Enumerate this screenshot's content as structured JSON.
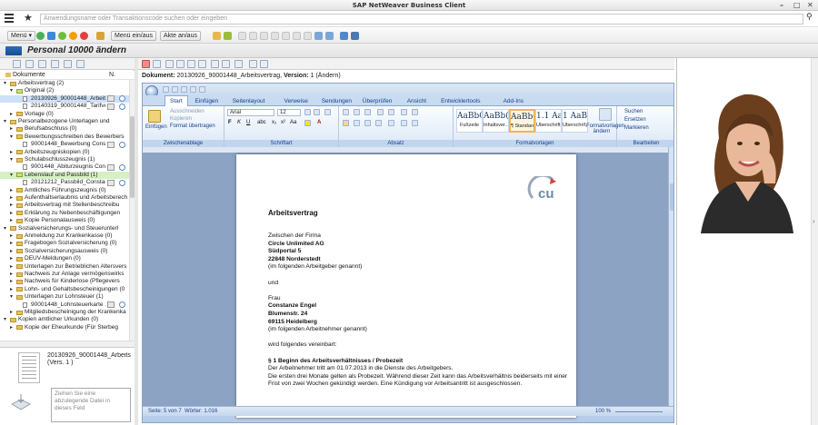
{
  "window": {
    "title": "SAP NetWeaver Business Client"
  },
  "command": {
    "placeholder": "Anwendungsname oder Transaktionscode suchen oder eingeben"
  },
  "toolbar": {
    "menu": "Menü",
    "menu_onoff": "Menü ein/aus",
    "file_onoff": "Akte an/aus"
  },
  "page": {
    "title": "Personal 10000 ändern"
  },
  "tree": {
    "header": "Dokumente",
    "col_n": "N.",
    "rows": [
      {
        "level": 1,
        "text": "Arbeitsvertrag (2)",
        "type": "folder",
        "exp": "open"
      },
      {
        "level": 2,
        "text": "Original (2)",
        "type": "folder-green",
        "exp": "open"
      },
      {
        "level": 3,
        "text": "20130926_90001448_Arbeitsv",
        "type": "doc",
        "selected": true,
        "icons": true
      },
      {
        "level": 3,
        "text": "20140319_90001448_Tarifvertr",
        "type": "doc",
        "icons": true
      },
      {
        "level": 2,
        "text": "Vorlage (0)",
        "type": "folder",
        "exp": "closed"
      },
      {
        "level": 1,
        "text": "Personalbezogene Unterlagen und",
        "type": "folder",
        "exp": "open"
      },
      {
        "level": 2,
        "text": "Berufsabschluss (0)",
        "type": "folder",
        "exp": "closed"
      },
      {
        "level": 2,
        "text": "Bewerbungsschreiben des Bewerbers",
        "type": "folder",
        "exp": "open"
      },
      {
        "level": 3,
        "text": "90001448_Bewerbung Constanz",
        "type": "doc",
        "icons": true
      },
      {
        "level": 2,
        "text": "Arbeitszeugniskopien (0)",
        "type": "folder",
        "exp": "closed"
      },
      {
        "level": 2,
        "text": "Schulabschlusszeugnis (1)",
        "type": "folder",
        "exp": "open"
      },
      {
        "level": 3,
        "text": "9001448_Abiturzeugnis Consta",
        "type": "doc",
        "icons": true
      },
      {
        "level": 2,
        "text": "Lebenslauf und Passbild (1)",
        "type": "folder-green",
        "exp": "open",
        "green": true
      },
      {
        "level": 3,
        "text": "20121212_Passbild_Constanze",
        "type": "doc",
        "icons": true
      },
      {
        "level": 2,
        "text": "Amtliches Führungszeugnis (0)",
        "type": "folder",
        "exp": "closed"
      },
      {
        "level": 2,
        "text": "Aufenthaltserlaubnis und Arbeitsberech",
        "type": "folder",
        "exp": "closed"
      },
      {
        "level": 2,
        "text": "Arbeitsvertrag mit Stellenbeschreibu",
        "type": "folder",
        "exp": "closed"
      },
      {
        "level": 2,
        "text": "Erklärung zu Nebenbeschäftigungen",
        "type": "folder",
        "exp": "closed"
      },
      {
        "level": 2,
        "text": "Kopie Personalausweis (0)",
        "type": "folder",
        "exp": "closed"
      },
      {
        "level": 1,
        "text": "Sozialversicherungs- und Steuerunterl",
        "type": "folder",
        "exp": "open"
      },
      {
        "level": 2,
        "text": "Anmeldung zur Krankenkasse (0)",
        "type": "folder",
        "exp": "closed"
      },
      {
        "level": 2,
        "text": "Fragebogen Sozialversicherung (0)",
        "type": "folder",
        "exp": "closed"
      },
      {
        "level": 2,
        "text": "Sozialversicherungsausweis (0)",
        "type": "folder",
        "exp": "closed"
      },
      {
        "level": 2,
        "text": "DEÜV-Meldungen (0)",
        "type": "folder",
        "exp": "closed"
      },
      {
        "level": 2,
        "text": "Unterlagen zur Betrieblichen Altersvers",
        "type": "folder",
        "exp": "closed"
      },
      {
        "level": 2,
        "text": "Nachweis zur Anlage vermögenswirks",
        "type": "folder",
        "exp": "closed"
      },
      {
        "level": 2,
        "text": "Nachweis für Kinderlose (Pflegevers",
        "type": "folder",
        "exp": "closed"
      },
      {
        "level": 2,
        "text": "Lohn- und Gehaltsbescheinigungen (0",
        "type": "folder",
        "exp": "closed"
      },
      {
        "level": 2,
        "text": "Unterlagen zur Lohnsteuer (1)",
        "type": "folder",
        "exp": "open"
      },
      {
        "level": 3,
        "text": "90001448_Lohnsteuerkarte 20",
        "type": "doc",
        "icons": true
      },
      {
        "level": 2,
        "text": "Mitgliedsbescheinigung der Krankenka",
        "type": "folder",
        "exp": "closed"
      },
      {
        "level": 1,
        "text": "Kopien amtlicher Urkunden (0)",
        "type": "folder",
        "exp": "open"
      },
      {
        "level": 2,
        "text": "Kopie der Eheurkunde (Für Sterbeg",
        "type": "folder",
        "exp": "closed"
      }
    ]
  },
  "preview": {
    "name": "20130926_90001448_Arbeitsve",
    "version": "(Vers. 1 )",
    "drop_hint": "Ziehen Sie eine abzulegende Datei in dieses Feld"
  },
  "document": {
    "label": "Dokument:",
    "name": "20130926_90001448_Arbeitsvertrag",
    "version_label": "Version:",
    "version": "1 (Ändern)"
  },
  "word": {
    "tabs": [
      "Start",
      "Einfügen",
      "Seitenlayout",
      "Verweise",
      "Sendungen",
      "Überprüfen",
      "Ansicht",
      "Entwicklertools",
      "Add-Ins"
    ],
    "clipboard": {
      "paste": "Einfügen",
      "cut": "Ausschneiden",
      "copy": "Kopieren",
      "format": "Format übertragen",
      "label": "Zwischenablage"
    },
    "font": {
      "name": "Arial",
      "size": "12",
      "label": "Schriftart"
    },
    "paragraph_label": "Absatz",
    "styles": [
      {
        "preview": "AaBbCcDdE",
        "name": "Fußzeile"
      },
      {
        "preview": "AaBb(",
        "name": "Inhaltsver..."
      },
      {
        "preview": "AaBbCcI",
        "name": "¶ Standard",
        "selected": true
      },
      {
        "preview": "1.1 AaE",
        "name": "Überschrift..."
      },
      {
        "preview": "1 AaB",
        "name": "Überschrif..."
      }
    ],
    "styles_label": "Formatvorlagen",
    "change_styles": "Formatvorlagen ändern",
    "edit": {
      "find": "Suchen",
      "replace": "Ersetzen",
      "select": "Markieren",
      "label": "Bearbeiten"
    },
    "status": {
      "page": "Seite: 5 von 7",
      "words": "Wörter: 1.016",
      "zoom": "100 %"
    }
  },
  "letter": {
    "title": "Arbeitsvertrag",
    "lines": [
      {
        "t": "Zwischen der Firma",
        "s": ""
      },
      {
        "t": "Circle Unlimited AG",
        "s": "b"
      },
      {
        "t": "Südportal 5",
        "s": "b"
      },
      {
        "t": "22848 Norderstedt",
        "s": "b"
      },
      {
        "t": "(im folgenden Arbeitgeber genannt)",
        "s": ""
      },
      {
        "t": "",
        "s": ""
      },
      {
        "t": "und",
        "s": ""
      },
      {
        "t": "",
        "s": ""
      },
      {
        "t": "Frau",
        "s": ""
      },
      {
        "t": "Constanze Engel",
        "s": "b"
      },
      {
        "t": "Blumenstr. 24",
        "s": "b"
      },
      {
        "t": "69115 Heidelberg",
        "s": "b"
      },
      {
        "t": "(im folgenden Arbeitnehmer genannt)",
        "s": ""
      },
      {
        "t": "",
        "s": ""
      },
      {
        "t": "wird folgendes vereinbart:",
        "s": ""
      },
      {
        "t": "",
        "s": ""
      },
      {
        "t": "§ 1 Beginn des Arbeitsverhältnisses  / Probezeit",
        "s": "b"
      },
      {
        "t": "Der Arbeitnehmer tritt am 01.07.2013  in die Dienste des Arbeitgebers.",
        "s": ""
      },
      {
        "t": "Die ersten drei Monate gelten als Probezeit. Während  dieser Zeit kann das Arbeitsverhältnis beiderseits mit einer",
        "s": ""
      },
      {
        "t": "Frist von zwei Wochen gekündigt werden.  Eine Kündigung vor Arbeitsantritt ist ausgeschlossen.",
        "s": ""
      }
    ],
    "logo_text": "cu"
  },
  "colors": {
    "accent": "#15428b",
    "selection": "#cfe0f7",
    "folder": "#e6c25a"
  }
}
